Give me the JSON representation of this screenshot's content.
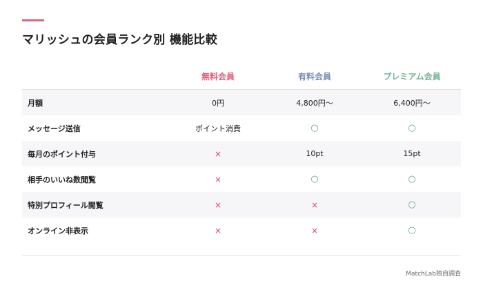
{
  "title": "マリッシュの会員ランク別 機能比較",
  "colors": {
    "accent": "#e0607e",
    "free": "#e0607e",
    "paid": "#7a8fb4",
    "premium": "#76b597",
    "mark_x": "#d9455f",
    "mark_o": "#5fa77a"
  },
  "table": {
    "headers": [
      "",
      "無料会員",
      "有料会員",
      "プレミアム会員"
    ],
    "rows": [
      {
        "feature": "月額",
        "free": "0円",
        "paid": "4,800円〜",
        "premium": "6,400円〜"
      },
      {
        "feature": "メッセージ送信",
        "free": "ポイント消費",
        "paid": "○",
        "premium": "○"
      },
      {
        "feature": "毎月のポイント付与",
        "free": "×",
        "paid": "10pt",
        "premium": "15pt"
      },
      {
        "feature": "相手のいいね数閲覧",
        "free": "×",
        "paid": "○",
        "premium": "○"
      },
      {
        "feature": "特別プロフィール閲覧",
        "free": "×",
        "paid": "×",
        "premium": "○"
      },
      {
        "feature": "オンライン非表示",
        "free": "×",
        "paid": "×",
        "premium": "○"
      }
    ]
  },
  "source": "MatchLab独自調査"
}
